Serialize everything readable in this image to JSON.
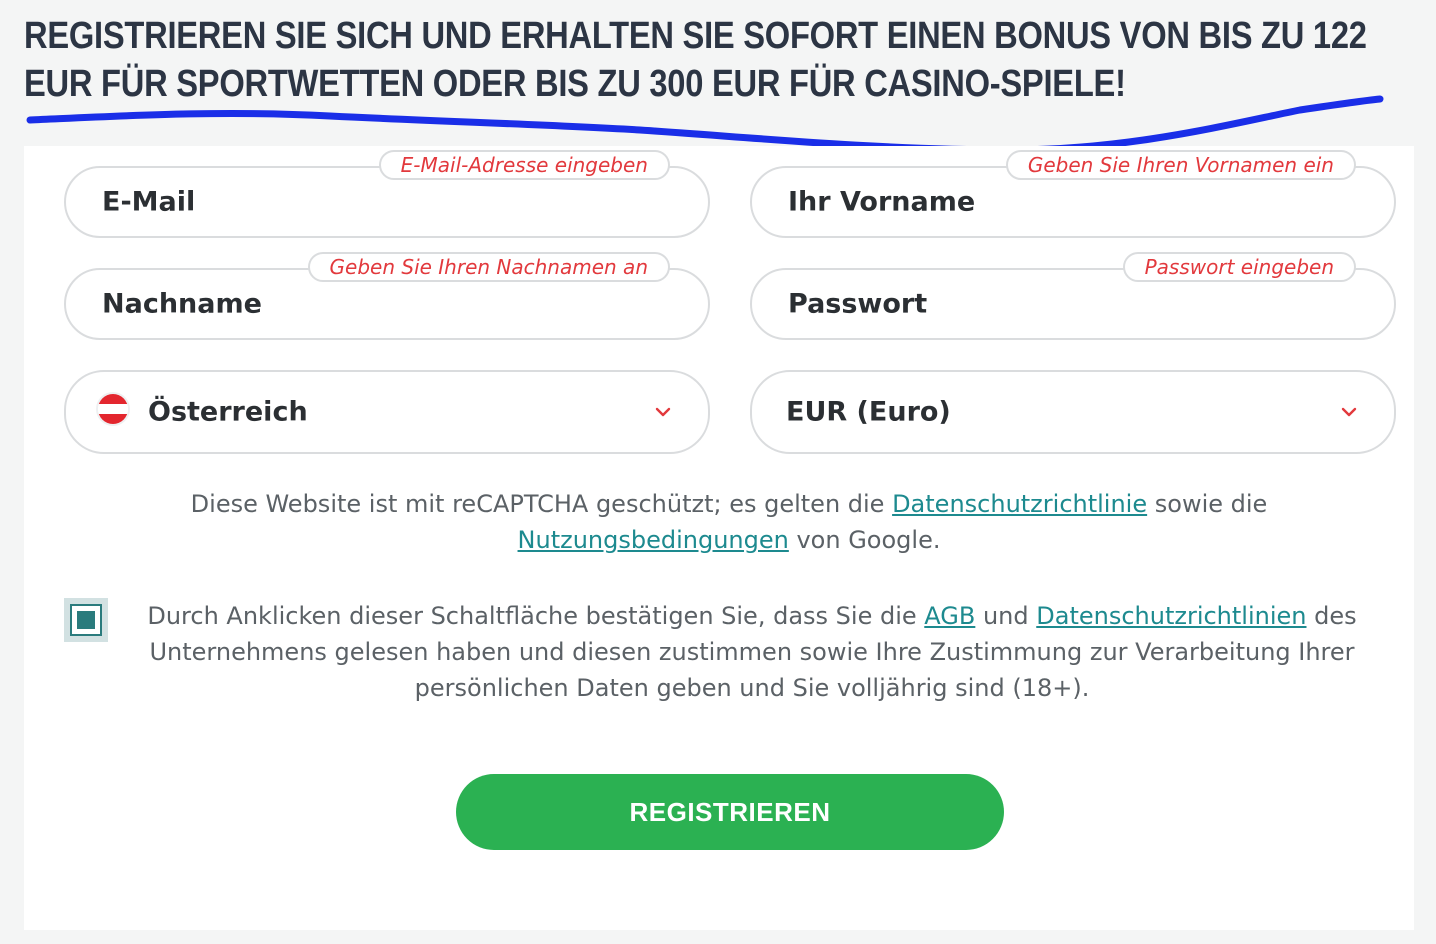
{
  "header": {
    "headline_line1": "REGISTRIEREN SIE SICH UND ERHALTEN SIE SOFORT EINEN BONUS VON BIS ZU 122",
    "headline_line2": "EUR FÜR SPORTWETTEN ODER BIS ZU 300 EUR FÜR CASINO-SPIELE!",
    "underline_color": "#1a2ee8"
  },
  "form": {
    "email": {
      "value": "E-Mail",
      "hint": "E-Mail-Adresse eingeben"
    },
    "first_name": {
      "value": "Ihr Vorname",
      "hint": "Geben Sie Ihren Vornamen ein"
    },
    "last_name": {
      "value": "Nachname",
      "hint": "Geben Sie Ihren Nachnamen an"
    },
    "password": {
      "value": "Passwort",
      "hint": "Passwort eingeben"
    },
    "country": {
      "value": "Österreich",
      "flag_icon": "austria-flag-icon"
    },
    "currency": {
      "value": "EUR (Euro)"
    }
  },
  "recaptcha": {
    "text_before": "Diese Website ist mit reCAPTCHA geschützt; es gelten die ",
    "privacy_link": "Datenschutzrichtlinie",
    "text_middle": " sowie die ",
    "terms_link": "Nutzungsbedingungen",
    "text_after": " von Google."
  },
  "consent": {
    "checked": true,
    "text_before": "Durch Anklicken dieser Schaltfläche bestätigen Sie, dass Sie die ",
    "agb_link": "AGB",
    "text_and": " und ",
    "privacy_link": "Datenschutzrichtlinien",
    "text_after": " des Unternehmens gelesen haben und diesen zustimmen sowie Ihre Zustimmung zur Verarbeitung Ihrer persönlichen Daten geben und Sie volljährig sind (18+)."
  },
  "submit": {
    "label": "REGISTRIEREN",
    "color": "#2bb152"
  },
  "colors": {
    "hint_text": "#e2393d",
    "link": "#1d8a8f",
    "headline": "#2c3544",
    "checkbox": "#2a7b7d"
  }
}
